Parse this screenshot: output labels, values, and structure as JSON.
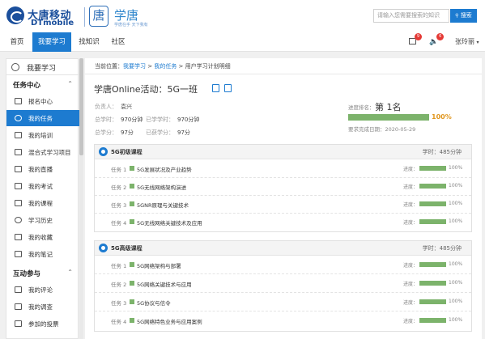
{
  "brand": {
    "company_cn": "大唐移动",
    "company_en": "DTmobile",
    "product_icon": "唐",
    "product_name": "学唐",
    "slogan": "学唐在手 天下我有"
  },
  "search": {
    "placeholder": "请输入您需要搜索的知识",
    "button": "搜索"
  },
  "nav": {
    "items": [
      "首页",
      "我要学习",
      "找知识",
      "社区"
    ],
    "active_index": 1
  },
  "header_right": {
    "msg_badge": "9",
    "notice_badge": "6",
    "user": "张玲丽"
  },
  "sidebar": {
    "title": "我要学习",
    "section1": {
      "label": "任务中心",
      "items": [
        "报名中心",
        "我的任务",
        "我的培训",
        "混合式学习项目",
        "我的直播",
        "我的考试",
        "我的课程",
        "学习历史",
        "我的收藏",
        "我的笔记"
      ],
      "active_index": 1
    },
    "section2": {
      "label": "互动参与",
      "items": [
        "我的评论",
        "我的调查",
        "参加的投票"
      ]
    }
  },
  "breadcrumb": {
    "prefix": "当前位置：",
    "items": [
      "我要学习",
      "我的任务",
      "用户学习计划明细"
    ],
    "sep": " > "
  },
  "activity": {
    "title": "学唐Online活动：5G一班",
    "leader_label": "负责人：",
    "leader": "袁兴",
    "total_time_label": "总学时：",
    "total_time": "970分钟",
    "learned_time_label": "已学学时：",
    "learned_time": "970分钟",
    "total_credits_label": "总学分：",
    "total_credits": "97分",
    "earned_credits_label": "已获学分：",
    "earned_credits": "97分",
    "rank_label": "进度排名：",
    "rank": "第 1名",
    "progress": 100,
    "progress_label": "100%",
    "deadline_label": "要求完成日期：",
    "deadline": "2020-05-29"
  },
  "courses": [
    {
      "title": "5G初级课程",
      "hours_label": "学时：",
      "hours": "485分钟",
      "tasks": [
        {
          "no": "任务 1",
          "name": "5G发展状况及产业趋势",
          "progress_label": "进度：",
          "progress": 100,
          "pct": "100%"
        },
        {
          "no": "任务 2",
          "name": "5G无线网络架构演进",
          "progress_label": "进度：",
          "progress": 100,
          "pct": "100%"
        },
        {
          "no": "任务 3",
          "name": "5GNR原理与关键技术",
          "progress_label": "进度：",
          "progress": 100,
          "pct": "100%"
        },
        {
          "no": "任务 4",
          "name": "5G无线网络关键技术及应用",
          "progress_label": "进度：",
          "progress": 100,
          "pct": "100%"
        }
      ]
    },
    {
      "title": "5G高级课程",
      "hours_label": "学时：",
      "hours": "485分钟",
      "tasks": [
        {
          "no": "任务 1",
          "name": "5G网络架构与部署",
          "progress_label": "进度：",
          "progress": 100,
          "pct": "100%"
        },
        {
          "no": "任务 2",
          "name": "5G网络关键技术与应用",
          "progress_label": "进度：",
          "progress": 100,
          "pct": "100%"
        },
        {
          "no": "任务 3",
          "name": "5G协议与信令",
          "progress_label": "进度：",
          "progress": 100,
          "pct": "100%"
        },
        {
          "no": "任务 4",
          "name": "5G网络特色业务与应用案例",
          "progress_label": "进度：",
          "progress": 100,
          "pct": "100%"
        }
      ]
    }
  ],
  "colors": {
    "accent": "#1d7bd0",
    "brand": "#1b4f9c",
    "progress": "#7cb36b",
    "highlight": "#e0961d",
    "badge": "#e53935"
  },
  "icons": {
    "message": "gift-icon",
    "notice": "speaker-icon",
    "user_menu": "chevron-down-icon",
    "pin": "location-pin-icon",
    "task": "green-square-icon"
  }
}
